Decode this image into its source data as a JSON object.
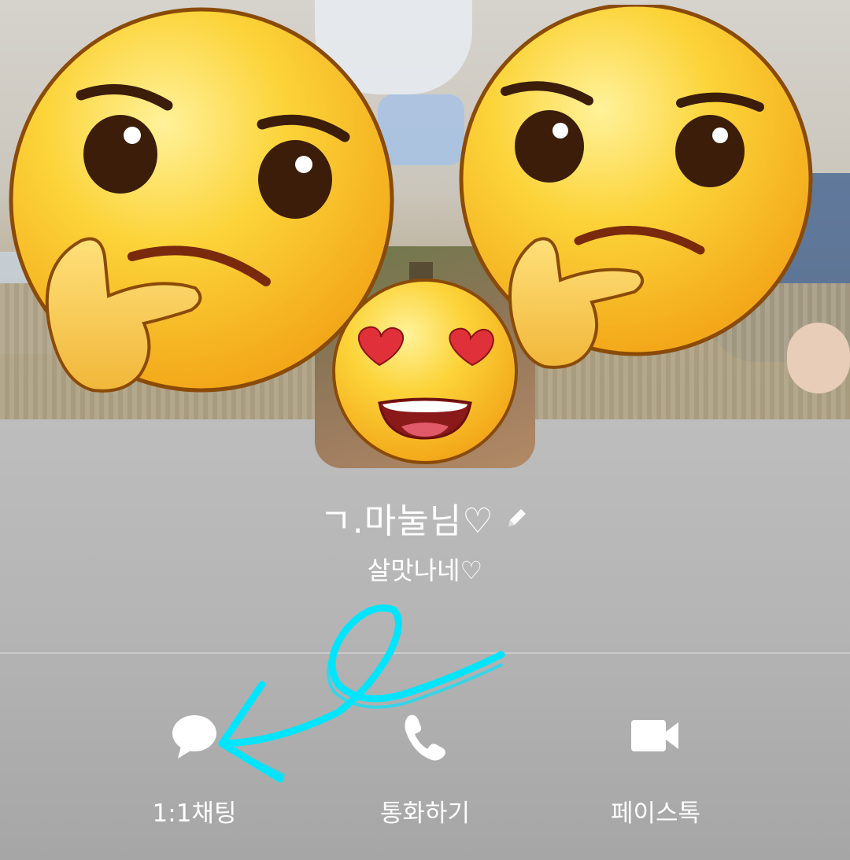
{
  "profile": {
    "name": "ㄱ.마눌님♡",
    "status_message": "살맛나네♡"
  },
  "actions": [
    {
      "label": "1:1채팅",
      "icon": "chat-bubble-icon"
    },
    {
      "label": "통화하기",
      "icon": "phone-icon"
    },
    {
      "label": "페이스톡",
      "icon": "video-camera-icon"
    }
  ],
  "overlays": {
    "stickers": [
      "thinking-face",
      "thinking-face",
      "heart-eyes-face"
    ],
    "annotation": "cyan-arrow-pointing-to-chat"
  },
  "colors": {
    "text": "#ffffff",
    "annotation": "#00e5ff",
    "emoji_yellow": "#fbc82c"
  }
}
